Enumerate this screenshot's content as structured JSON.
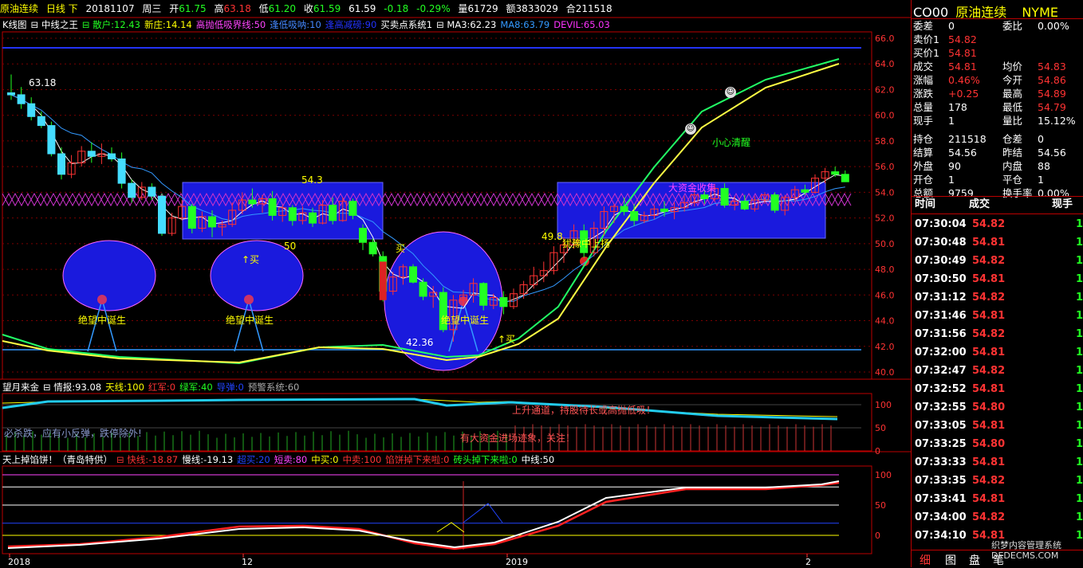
{
  "header": {
    "name": "原油连续",
    "period": "日线 下",
    "date": "20181107",
    "weekday": "周三",
    "open_label": "开",
    "open": "61.75",
    "high_label": "高",
    "high": "63.18",
    "low_label": "低",
    "low": "61.20",
    "close_label": "收",
    "close": "61.59",
    "prev": "61.59",
    "change": "-0.18",
    "change_pct": "-0.29%",
    "vol_label": "量",
    "vol": "61729",
    "amt_label": "额",
    "amt": "3833029",
    "oi_label": "合",
    "oi": "211518"
  },
  "main_indicators": [
    {
      "text": "K线图",
      "color": "#ffffff"
    },
    {
      "text": "⊟ 中线之王",
      "color": "#ffffff"
    },
    {
      "text": "⊟ 散户:12.43",
      "color": "#22ff22"
    },
    {
      "text": "新庄:14.14",
      "color": "#ffff00"
    },
    {
      "text": "高抛低吸界线:50",
      "color": "#ff44ff"
    },
    {
      "text": "逢低吸呐:10",
      "color": "#4488ff"
    },
    {
      "text": "逢高减磅:90",
      "color": "#2233ff"
    },
    {
      "text": "买卖点系统1",
      "color": "#ffffff"
    },
    {
      "text": "⊟ MA3:62.23",
      "color": "#ffffff"
    },
    {
      "text": "MA8:63.79",
      "color": "#3399ff"
    },
    {
      "text": "DEVIL:65.03",
      "color": "#ff33ff"
    }
  ],
  "mid_indicators": [
    {
      "text": "望月来金",
      "color": "#ffffff"
    },
    {
      "text": "⊟ 情报:93.08",
      "color": "#ffffff"
    },
    {
      "text": "天线:100",
      "color": "#ffff00"
    },
    {
      "text": "红军:0",
      "color": "#ff3333"
    },
    {
      "text": "绿军:40",
      "color": "#22ff22"
    },
    {
      "text": "导弹:0",
      "color": "#2244ff"
    },
    {
      "text": "预警系统:60",
      "color": "#aaaaaa"
    }
  ],
  "bot_indicators": [
    {
      "text": "天上掉馅饼！（青岛特供）",
      "color": "#ffffff"
    },
    {
      "text": "⊟ 快线:-18.87",
      "color": "#ff3333"
    },
    {
      "text": "慢线:-19.13",
      "color": "#ffffff"
    },
    {
      "text": "超买:20",
      "color": "#2244ff"
    },
    {
      "text": "短卖:80",
      "color": "#ff44ff"
    },
    {
      "text": "中买:0",
      "color": "#ffff00"
    },
    {
      "text": "中卖:100",
      "color": "#ff3333"
    },
    {
      "text": "馅饼掉下来啦:0",
      "color": "#ff3333"
    },
    {
      "text": "砖头掉下来啦:0",
      "color": "#22ff22"
    },
    {
      "text": "中线:50",
      "color": "#ffffff"
    }
  ],
  "price_axis": [
    "66.0",
    "64.0",
    "62.0",
    "60.0",
    "58.0",
    "56.0",
    "54.0",
    "52.0",
    "50.0",
    "48.0",
    "46.0",
    "44.0",
    "42.0",
    "40.0"
  ],
  "mid_axis": [
    "100",
    "50",
    "0"
  ],
  "bot_axis": [
    "100",
    "50",
    "0"
  ],
  "x_axis": [
    "2018",
    "12",
    "2019",
    "2"
  ],
  "annotations": {
    "high_mark": "63.18",
    "box1_top": "54.3",
    "box1_bottom": "50",
    "low_mark": "42.36",
    "mark_498": "49.8",
    "buy1": "↑买",
    "buy2": "↑买",
    "buy3": "买",
    "despair": "绝望中诞生",
    "careful": "小心清醒",
    "hesitate": "犹豫中上扬",
    "big_money": "大资金收集",
    "uptrend": "上升通道，持股待长或高抛低吸！",
    "must_fall": "必杀跌，应有小反弹，跌停除外!",
    "funds_enter": "有大资金进场迹象，关注！"
  },
  "quote": {
    "code": "CO00",
    "name": "原油连续",
    "exchange": "NYME",
    "rows": [
      {
        "l1": "委差",
        "v1": "0",
        "c1": "#ffffff",
        "l2": "委比",
        "v2": "0.00%",
        "c2": "#ffffff"
      },
      {
        "l1": "卖价1",
        "v1": "54.82",
        "c1": "#ff3333"
      },
      {
        "l1": "买价1",
        "v1": "54.81",
        "c1": "#ff3333"
      },
      {
        "l1": "成交",
        "v1": "54.81",
        "c1": "#ff3333",
        "l2": "均价",
        "v2": "54.83",
        "c2": "#ff3333"
      },
      {
        "l1": "涨幅",
        "v1": "0.46%",
        "c1": "#ff3333",
        "l2": "今开",
        "v2": "54.86",
        "c2": "#ff3333"
      },
      {
        "l1": "涨跌",
        "v1": "+0.25",
        "c1": "#ff3333",
        "l2": "最高",
        "v2": "54.89",
        "c2": "#ff3333"
      },
      {
        "l1": "总量",
        "v1": "178",
        "c1": "#ffffff",
        "l2": "最低",
        "v2": "54.79",
        "c2": "#ff3333"
      },
      {
        "l1": "现手",
        "v1": "1",
        "c1": "#ffffff",
        "l2": "量比",
        "v2": "15.12%",
        "c2": "#ffffff"
      },
      {
        "l1": "持仓",
        "v1": "211518",
        "c1": "#ffffff",
        "l2": "仓差",
        "v2": "0",
        "c2": "#ffffff"
      },
      {
        "l1": "结算",
        "v1": "54.56",
        "c1": "#ffffff",
        "l2": "昨结",
        "v2": "54.56",
        "c2": "#ffffff"
      },
      {
        "l1": "外盘",
        "v1": "90",
        "c1": "#ffffff",
        "l2": "内盘",
        "v2": "88",
        "c2": "#ffffff"
      },
      {
        "l1": "开仓",
        "v1": "1",
        "c1": "#ffffff",
        "l2": "平仓",
        "v2": "1",
        "c2": "#ffffff"
      },
      {
        "l1": "总额",
        "v1": "9759",
        "c1": "#ffffff",
        "l2": "换手率",
        "v2": "0.00%",
        "c2": "#ffffff"
      }
    ]
  },
  "ticks": {
    "headers": [
      "时间",
      "成交",
      "现手"
    ],
    "rows": [
      {
        "time": "07:30:04",
        "price": "54.82",
        "vol": "1"
      },
      {
        "time": "07:30:48",
        "price": "54.81",
        "vol": "1"
      },
      {
        "time": "07:30:49",
        "price": "54.82",
        "vol": "1"
      },
      {
        "time": "07:30:50",
        "price": "54.81",
        "vol": "1"
      },
      {
        "time": "07:31:12",
        "price": "54.82",
        "vol": "1"
      },
      {
        "time": "07:31:46",
        "price": "54.81",
        "vol": "1"
      },
      {
        "time": "07:31:56",
        "price": "54.82",
        "vol": "1"
      },
      {
        "time": "07:32:00",
        "price": "54.81",
        "vol": "1"
      },
      {
        "time": "07:32:47",
        "price": "54.82",
        "vol": "1"
      },
      {
        "time": "07:32:52",
        "price": "54.81",
        "vol": "1"
      },
      {
        "time": "07:32:55",
        "price": "54.80",
        "vol": "1"
      },
      {
        "time": "07:33:05",
        "price": "54.81",
        "vol": "1"
      },
      {
        "time": "07:33:25",
        "price": "54.80",
        "vol": "1"
      },
      {
        "time": "07:33:33",
        "price": "54.81",
        "vol": "1"
      },
      {
        "time": "07:33:35",
        "price": "54.82",
        "vol": "1"
      },
      {
        "time": "07:33:41",
        "price": "54.81",
        "vol": "1"
      },
      {
        "time": "07:34:00",
        "price": "54.82",
        "vol": "1"
      },
      {
        "time": "07:34:10",
        "price": "54.81",
        "vol": "1"
      }
    ]
  },
  "tabs": [
    "细",
    "图",
    "盘",
    "笔"
  ],
  "watermark": "织梦内容管理系统 DEDECMS.COM",
  "candles": [
    [
      61.75,
      63.18,
      61.2,
      61.59
    ],
    [
      61.6,
      62.2,
      60.5,
      60.9
    ],
    [
      60.9,
      61.4,
      59.6,
      59.9
    ],
    [
      59.9,
      60.3,
      59.0,
      59.2
    ],
    [
      59.2,
      59.5,
      56.8,
      57.0
    ],
    [
      57.0,
      57.5,
      55.0,
      55.4
    ],
    [
      55.4,
      56.9,
      55.1,
      56.3
    ],
    [
      56.3,
      57.6,
      56.0,
      57.2
    ],
    [
      57.2,
      57.9,
      56.3,
      56.8
    ],
    [
      56.8,
      57.8,
      56.2,
      57.0
    ],
    [
      57.0,
      57.5,
      56.4,
      56.6
    ],
    [
      56.6,
      57.1,
      54.3,
      54.7
    ],
    [
      54.7,
      55.0,
      53.2,
      53.6
    ],
    [
      53.6,
      54.8,
      53.4,
      54.4
    ],
    [
      54.4,
      54.7,
      53.4,
      53.7
    ],
    [
      53.7,
      53.9,
      50.6,
      50.8
    ],
    [
      50.8,
      52.4,
      50.6,
      52.0
    ],
    [
      52.0,
      53.4,
      51.8,
      52.9
    ],
    [
      52.9,
      53.1,
      50.8,
      51.2
    ],
    [
      51.2,
      52.5,
      50.9,
      52.1
    ],
    [
      52.1,
      52.6,
      50.5,
      51.3
    ],
    [
      51.3,
      51.8,
      50.6,
      51.5
    ],
    [
      51.5,
      53.2,
      51.3,
      52.6
    ],
    [
      52.6,
      54.0,
      52.3,
      53.4
    ],
    [
      53.4,
      54.3,
      52.8,
      53.1
    ],
    [
      53.1,
      53.8,
      52.4,
      53.5
    ],
    [
      53.5,
      54.1,
      51.8,
      52.2
    ],
    [
      52.2,
      53.0,
      51.7,
      52.8
    ],
    [
      52.8,
      53.0,
      51.4,
      51.8
    ],
    [
      51.8,
      52.9,
      51.5,
      52.4
    ],
    [
      52.4,
      52.8,
      51.3,
      51.6
    ],
    [
      51.6,
      53.4,
      51.5,
      53.0
    ],
    [
      53.0,
      53.6,
      51.5,
      51.8
    ],
    [
      51.8,
      53.6,
      51.7,
      53.3
    ],
    [
      53.3,
      53.5,
      51.9,
      52.2
    ],
    [
      51.2,
      51.5,
      49.5,
      50.1
    ],
    [
      50.1,
      50.4,
      49.0,
      49.2
    ],
    [
      49.0,
      49.4,
      45.5,
      46.3
    ],
    [
      46.3,
      47.8,
      46.0,
      47.4
    ],
    [
      47.4,
      48.4,
      46.8,
      48.2
    ],
    [
      48.2,
      48.4,
      46.9,
      47.0
    ],
    [
      47.0,
      47.3,
      45.6,
      45.9
    ],
    [
      45.9,
      46.7,
      45.0,
      46.2
    ],
    [
      46.2,
      46.6,
      43.1,
      43.3
    ],
    [
      43.3,
      46.0,
      42.36,
      45.6
    ],
    [
      45.6,
      46.4,
      45.1,
      46.0
    ],
    [
      46.0,
      47.3,
      45.4,
      46.9
    ],
    [
      46.9,
      47.0,
      44.8,
      45.2
    ],
    [
      45.2,
      46.1,
      44.9,
      45.8
    ],
    [
      45.8,
      46.3,
      44.5,
      45.1
    ],
    [
      45.1,
      46.5,
      44.9,
      46.1
    ],
    [
      46.1,
      47.1,
      45.7,
      46.8
    ],
    [
      46.8,
      48.2,
      46.5,
      47.5
    ],
    [
      47.5,
      48.6,
      47.0,
      47.9
    ],
    [
      47.9,
      49.8,
      47.6,
      49.3
    ],
    [
      49.3,
      50.5,
      48.5,
      49.9
    ],
    [
      49.9,
      51.5,
      49.6,
      51.0
    ],
    [
      51.0,
      51.5,
      48.9,
      49.3
    ],
    [
      49.3,
      51.7,
      49.0,
      51.2
    ],
    [
      51.2,
      52.9,
      50.6,
      52.5
    ],
    [
      52.5,
      53.1,
      51.6,
      52.9
    ],
    [
      52.9,
      53.6,
      52.2,
      52.5
    ],
    [
      52.5,
      53.1,
      51.4,
      51.8
    ],
    [
      51.8,
      52.5,
      51.6,
      52.2
    ],
    [
      52.2,
      53.0,
      51.9,
      52.7
    ],
    [
      52.7,
      53.3,
      52.1,
      52.5
    ],
    [
      52.5,
      53.2,
      51.9,
      52.8
    ],
    [
      52.8,
      53.7,
      52.5,
      53.2
    ],
    [
      53.2,
      54.3,
      52.9,
      53.8
    ],
    [
      53.8,
      54.2,
      53.1,
      53.5
    ],
    [
      53.5,
      54.6,
      53.3,
      54.3
    ],
    [
      54.3,
      54.7,
      52.8,
      53.0
    ],
    [
      53.0,
      53.7,
      52.6,
      53.3
    ],
    [
      53.3,
      53.8,
      52.6,
      52.7
    ],
    [
      52.7,
      53.7,
      52.5,
      53.4
    ],
    [
      53.4,
      54.0,
      53.1,
      53.8
    ],
    [
      53.8,
      54.0,
      52.4,
      52.6
    ],
    [
      52.6,
      53.8,
      52.2,
      53.6
    ],
    [
      53.6,
      54.5,
      53.3,
      54.2
    ],
    [
      54.2,
      54.6,
      53.8,
      54.0
    ],
    [
      54.0,
      55.4,
      53.9,
      55.1
    ],
    [
      55.1,
      55.9,
      54.7,
      55.6
    ],
    [
      55.6,
      56.0,
      55.2,
      55.4
    ],
    [
      55.4,
      55.7,
      54.8,
      54.82
    ]
  ]
}
